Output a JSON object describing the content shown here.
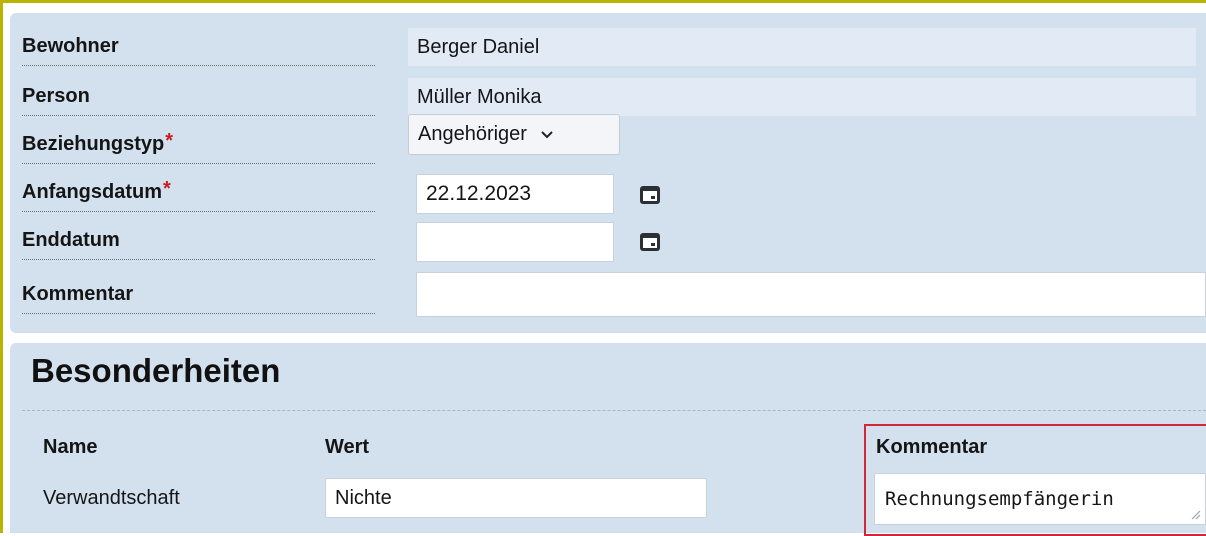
{
  "form": {
    "fields": [
      {
        "label": "Bewohner",
        "value": "Berger Daniel",
        "required": false
      },
      {
        "label": "Person",
        "value": "Müller Monika",
        "required": false
      },
      {
        "label": "Beziehungstyp",
        "value": "Angehöriger",
        "required": true
      },
      {
        "label": "Anfangsdatum",
        "value": "22.12.2023",
        "required": true
      },
      {
        "label": "Enddatum",
        "value": "",
        "required": false
      },
      {
        "label": "Kommentar",
        "value": "",
        "required": false
      }
    ],
    "required_marker": "*",
    "select_chevron": "⌄"
  },
  "besonderheiten": {
    "title": "Besonderheiten",
    "columns": {
      "name": "Name",
      "wert": "Wert",
      "kommentar": "Kommentar"
    },
    "rows": [
      {
        "name": "Verwandtschaft",
        "wert": "Nichte",
        "kommentar": "Rechnungsempfängerin"
      }
    ]
  },
  "icons": {
    "calendar": "calendar-icon",
    "resize": "resize-grip-icon",
    "dropdown": "chevron-down-icon"
  },
  "colors": {
    "panel": "#d3e1ef",
    "readonly_field": "#e2ebf5",
    "required": "#cc1b1b",
    "highlight_border": "#d2263a",
    "frame_border": "#b8b400"
  }
}
